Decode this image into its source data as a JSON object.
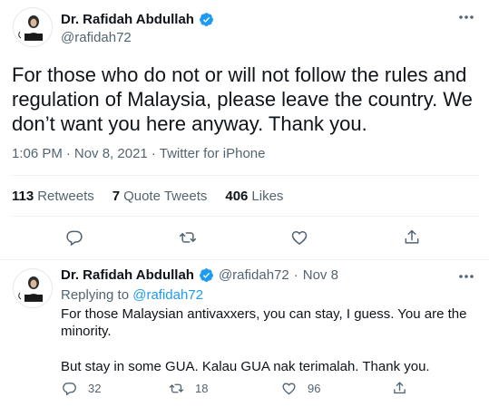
{
  "main_tweet": {
    "display_name": "Dr. Rafidah Abdullah",
    "handle": "@rafidah72",
    "text": "For those who do not or will not follow the rules and regulation of Malaysia, please leave the country. We don’t want you here anyway. Thank you.",
    "time": "1:06 PM",
    "date": "Nov 8, 2021",
    "source": "Twitter for iPhone",
    "separator": "·",
    "stats": {
      "retweets_count": "113",
      "retweets_label": "Retweets",
      "quotes_count": "7",
      "quotes_label": "Quote Tweets",
      "likes_count": "406",
      "likes_label": "Likes"
    }
  },
  "reply_tweet": {
    "display_name": "Dr. Rafidah Abdullah",
    "handle": "@rafidah72",
    "separator": "·",
    "date": "Nov 8",
    "replying_prefix": "Replying to",
    "replying_to": "@rafidah72",
    "text_line1": "For those Malaysian antivaxxers, you can stay, I guess. You are the minority.",
    "text_line2": "But stay in some GUA. Kalau GUA nak terimalah. Thank you.",
    "reply_count": "32",
    "retweet_count": "18",
    "like_count": "96"
  },
  "colors": {
    "verified_blue": "#1d9bf0",
    "text_primary": "#0f1419",
    "text_secondary": "#536471",
    "link": "#1d9bf0"
  },
  "icons": [
    "verified-badge-icon",
    "more-icon",
    "reply-icon",
    "retweet-icon",
    "like-icon",
    "share-icon"
  ]
}
